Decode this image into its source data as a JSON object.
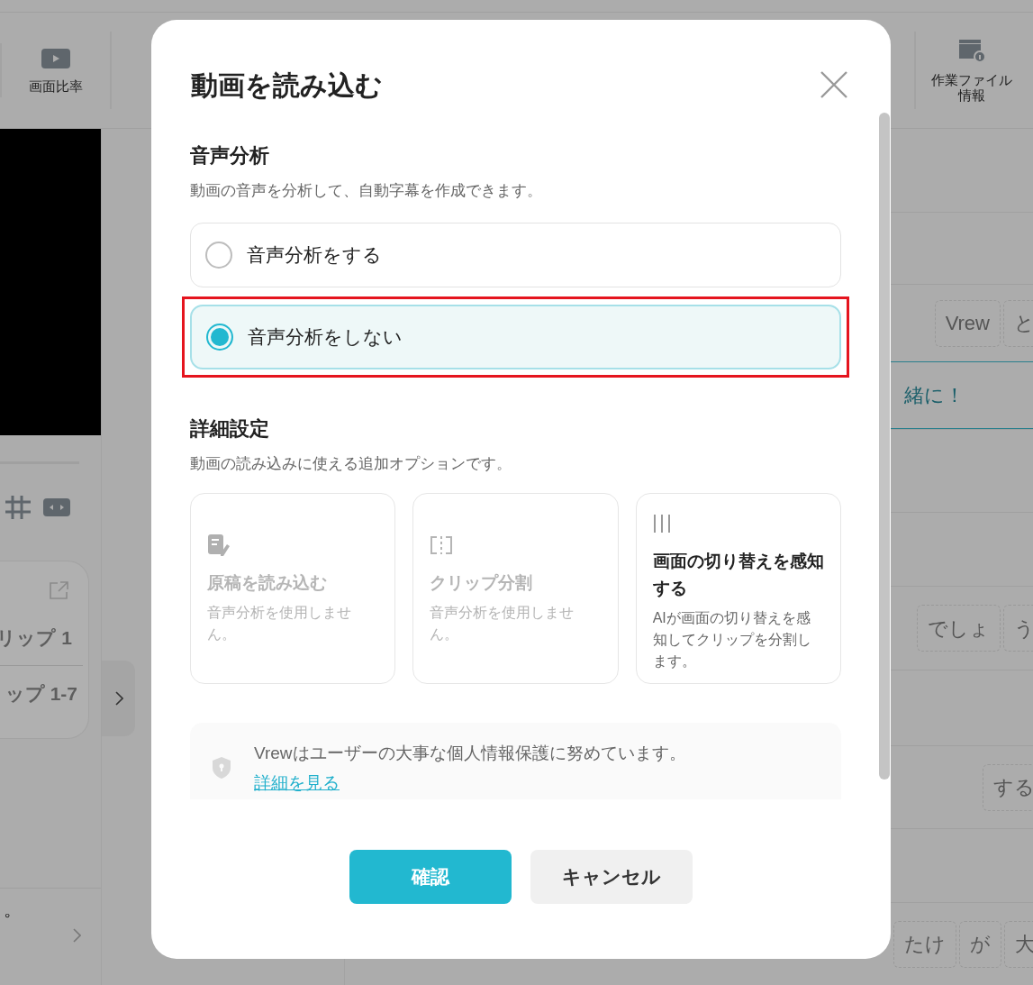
{
  "background": {
    "toolbar": [
      {
        "label": "画面比率",
        "kind": "aspect"
      },
      {
        "label": "作業ファイル情報",
        "kind": "fileinfo"
      }
    ],
    "clips": [
      "リップ 1",
      "ップ 1-7"
    ],
    "caption_end": "。",
    "rows": [
      {
        "words": []
      },
      {
        "words": [
          "Vrew",
          "と"
        ]
      },
      {
        "text": "緒に！"
      },
      {
        "words": []
      },
      {
        "words": []
      },
      {
        "words": [
          "でしょ",
          "う"
        ]
      },
      {
        "words": []
      },
      {
        "words": [
          "する"
        ]
      },
      {
        "words": []
      },
      {
        "words": [
          "たけ",
          "が",
          "大"
        ]
      }
    ]
  },
  "dialog": {
    "title": "動画を読み込む",
    "audio_analysis": {
      "heading": "音声分析",
      "description": "動画の音声を分析して、自動字幕を作成できます。",
      "options": [
        {
          "label": "音声分析をする",
          "selected": false,
          "highlighted": false
        },
        {
          "label": "音声分析をしない",
          "selected": true,
          "highlighted": true
        }
      ]
    },
    "advanced": {
      "heading": "詳細設定",
      "description": "動画の読み込みに使える追加オプションです。",
      "cards": [
        {
          "kind": "script",
          "title": "原稿を読み込む",
          "description": "音声分析を使用しません。",
          "disabled": true
        },
        {
          "kind": "split",
          "title": "クリップ分割",
          "description": "音声分析を使用しません。",
          "disabled": true
        },
        {
          "kind": "scene",
          "title": "画面の切り替えを感知する",
          "description": "AIが画面の切り替えを感知してクリップを分割します。",
          "disabled": false
        }
      ]
    },
    "privacy": {
      "text": "Vrewはユーザーの大事な個人情報保護に努めています。",
      "link": "詳細を見る"
    },
    "buttons": [
      {
        "label": "確認",
        "kind": "primary"
      },
      {
        "label": "キャンセル",
        "kind": "secondary"
      }
    ]
  }
}
